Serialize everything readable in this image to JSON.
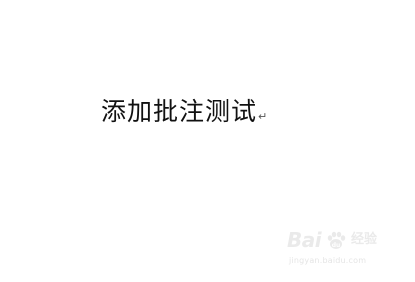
{
  "document": {
    "text": "添加批注测试",
    "paragraph_mark": "↵"
  },
  "watermark": {
    "logo_text": "Bai",
    "logo_paw": "du",
    "product": "经验",
    "url": "jingyan.baidu.com"
  }
}
